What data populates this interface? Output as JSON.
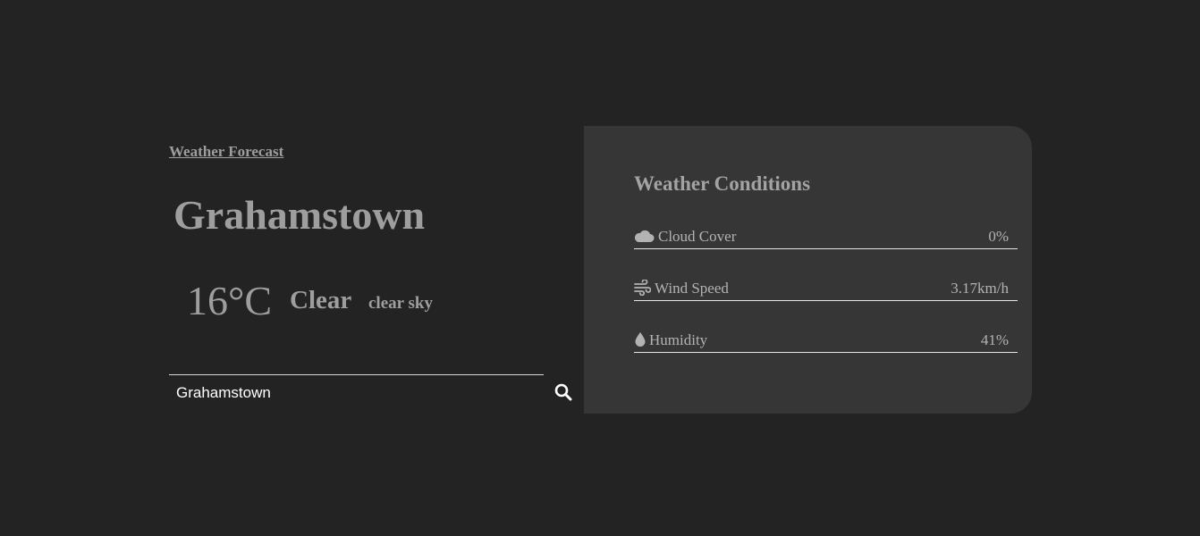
{
  "app": {
    "title": "Weather Forecast"
  },
  "current": {
    "city": "Grahamstown",
    "temperature": "16°C",
    "condition": "Clear",
    "description": "clear sky"
  },
  "search": {
    "value": "Grahamstown",
    "icon": "search-icon"
  },
  "conditions": {
    "title": "Weather Conditions",
    "rows": [
      {
        "label": "Cloud Cover",
        "value": "0%",
        "icon": "cloud-icon"
      },
      {
        "label": "Wind Speed",
        "value": "3.17km/h",
        "icon": "wind-icon"
      },
      {
        "label": "Humidity",
        "value": "41%",
        "icon": "droplet-icon"
      }
    ]
  },
  "colors": {
    "background": "#232323",
    "panel": "#363636",
    "text": "#9e9e9e"
  }
}
